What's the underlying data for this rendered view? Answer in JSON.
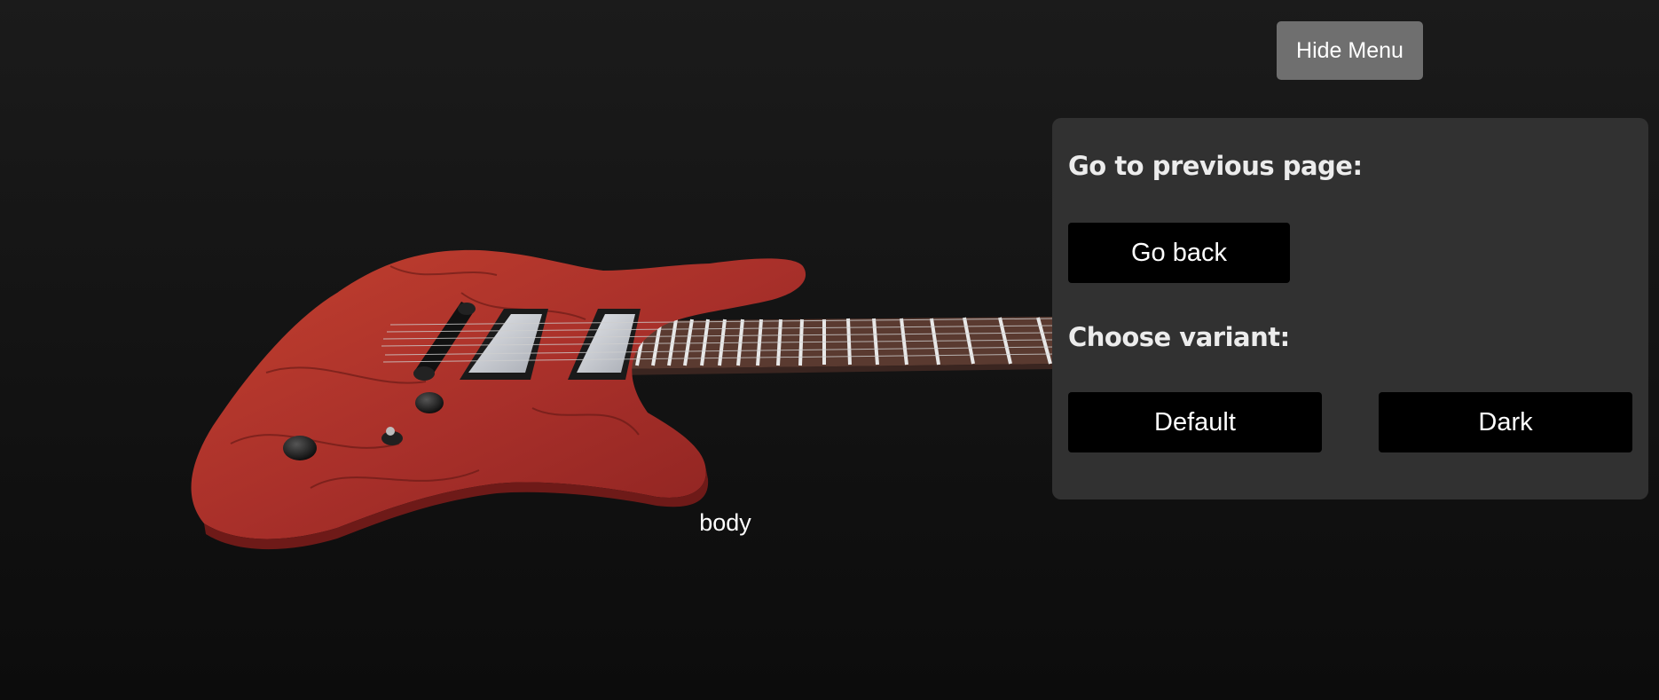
{
  "viewer": {
    "hovered_part_label": "body"
  },
  "toolbar": {
    "hide_menu_label": "Hide Menu"
  },
  "menu": {
    "previous_page_title": "Go to previous page:",
    "go_back_label": "Go back",
    "variant_title": "Choose variant:",
    "variants": [
      "Default",
      "Dark"
    ]
  },
  "colors": {
    "background": "#151515",
    "panel": "#313131",
    "button": "#000000",
    "hide_menu_button": "#6f6f6f",
    "guitar_body": "#b8342a",
    "fretboard": "#5a3a30"
  }
}
